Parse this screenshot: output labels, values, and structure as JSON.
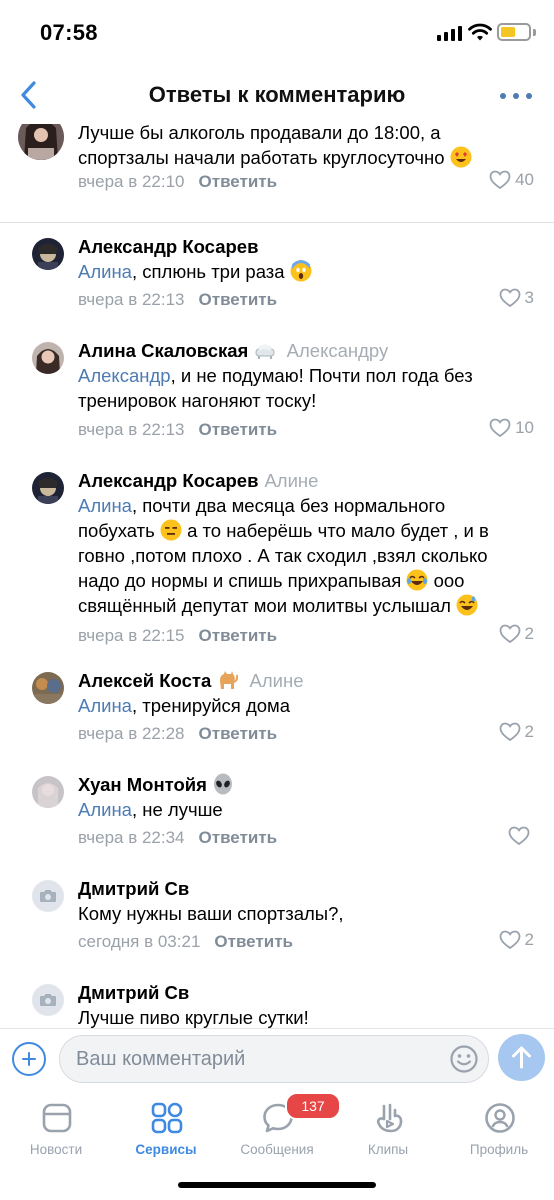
{
  "status_bar": {
    "time": "07:58"
  },
  "header": {
    "title": "Ответы к комментарию"
  },
  "colors": {
    "accent": "#3f8ae0",
    "mention": "#4d7bb3",
    "meta": "#9aa1a8",
    "badge": "#e64646"
  },
  "top_comment": {
    "text_line1": "Лучше бы алкоголь продавали до 18:00, а",
    "text_line2": "спортзалы начали работать круглосуточно",
    "time": "вчера в 22:10",
    "reply_label": "Ответить",
    "likes": "40"
  },
  "replies": [
    {
      "author": "Александр Косарев",
      "reply_to": "",
      "mention": "Алина",
      "text": ", сплюнь три раза",
      "time": "вчера в 22:13",
      "reply_label": "Ответить",
      "likes": "3"
    },
    {
      "author": "Алина Скаловская",
      "reply_to": "Александру",
      "mention": "Александр",
      "text": ", и не подумаю! Почти пол года без",
      "text2": "тренировок нагоняют тоску!",
      "time": "вчера в 22:13",
      "reply_label": "Ответить",
      "likes": "10"
    },
    {
      "author": "Александр Косарев",
      "reply_to": "Алине",
      "mention": "Алина",
      "text": ", почти два месяца без нормального",
      "text2": "побухать",
      "text3": " а то наберёшь что мало будет , и в",
      "text4": "говно ,потом плохо . А так сходил ,взял сколько",
      "text5": "надо до нормы и спишь прихрапывая",
      "text6": " ооо",
      "text7": "свящённый депутат мои молитвы услышал",
      "time": "вчера в 22:15",
      "reply_label": "Ответить",
      "likes": "2"
    },
    {
      "author": "Алексей Коста",
      "reply_to": "Алине",
      "mention": "Алина",
      "text": ", тренируйся дома",
      "time": "вчера в 22:28",
      "reply_label": "Ответить",
      "likes": "2"
    },
    {
      "author": "Хуан Монтойя",
      "reply_to": "",
      "mention": "Алина",
      "text": ", не лучше",
      "time": "вчера в 22:34",
      "reply_label": "Ответить",
      "likes": ""
    },
    {
      "author": "Дмитрий Св",
      "reply_to": "",
      "mention": "",
      "text": "Кому нужны ваши спортзалы?,",
      "time": "сегодня в 03:21",
      "reply_label": "Ответить",
      "likes": "2"
    },
    {
      "author": "Дмитрий Св",
      "reply_to": "",
      "mention": "",
      "text": "Лучше пиво круглые сутки!",
      "time": "",
      "reply_label": "",
      "likes": ""
    }
  ],
  "compose": {
    "placeholder": "Ваш комментарий"
  },
  "tabs": [
    {
      "label": "Новости",
      "icon": "news-icon"
    },
    {
      "label": "Сервисы",
      "icon": "services-icon",
      "active": true
    },
    {
      "label": "Сообщения",
      "icon": "messages-icon",
      "badge": "137"
    },
    {
      "label": "Клипы",
      "icon": "clips-icon"
    },
    {
      "label": "Профиль",
      "icon": "profile-icon"
    }
  ]
}
